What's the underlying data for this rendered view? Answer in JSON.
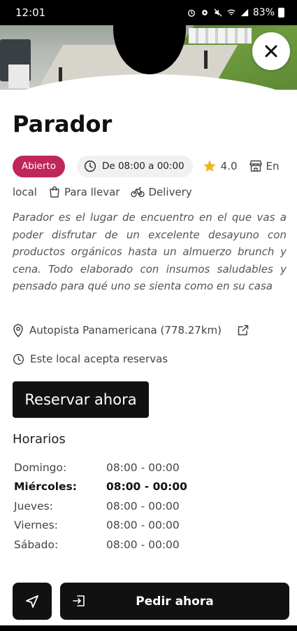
{
  "status_bar": {
    "time": "12:01",
    "battery": "83%"
  },
  "venue": {
    "name": "Parador",
    "status_badge": "Abierto",
    "hours": "De 08:00 a 00:00",
    "rating": "4.0",
    "services": {
      "dine_in_part1": "En",
      "dine_in_part2": "local",
      "takeaway": "Para llevar",
      "delivery": "Delivery"
    },
    "description": "Parador es el lugar de encuentro en el que vas a poder disfrutar de un excelente desayuno con productos orgánicos hasta un almuerzo brunch y cena. Todo elaborado con insumos saludables y pensado para qué uno se sienta como en su casa",
    "address": "Autopista Panamericana (778.27km)",
    "reservations_note": "Este local acepta reservas"
  },
  "buttons": {
    "reserve": "Reservar ahora",
    "order": "Pedir ahora"
  },
  "schedule": {
    "title": "Horarios",
    "rows": [
      {
        "day": "Domingo:",
        "hours": "08:00 - 00:00",
        "today": false
      },
      {
        "day": "Miércoles:",
        "hours": "08:00 - 00:00",
        "today": true
      },
      {
        "day": "Jueves:",
        "hours": "08:00 - 00:00",
        "today": false
      },
      {
        "day": "Viernes:",
        "hours": "08:00 - 00:00",
        "today": false
      },
      {
        "day": "Sábado:",
        "hours": "08:00 - 00:00",
        "today": false
      }
    ]
  },
  "icons": {
    "close": "close-icon",
    "clock": "clock-icon",
    "star": "star-icon",
    "store": "store-icon",
    "bag": "bag-icon",
    "bike": "bike-icon",
    "pin": "location-pin-icon",
    "external": "external-link-icon",
    "navigate": "navigation-arrow-icon",
    "login": "enter-icon"
  },
  "colors": {
    "badge_open": "#c0265a",
    "star": "#f2b51c",
    "button_dark": "#111111"
  }
}
